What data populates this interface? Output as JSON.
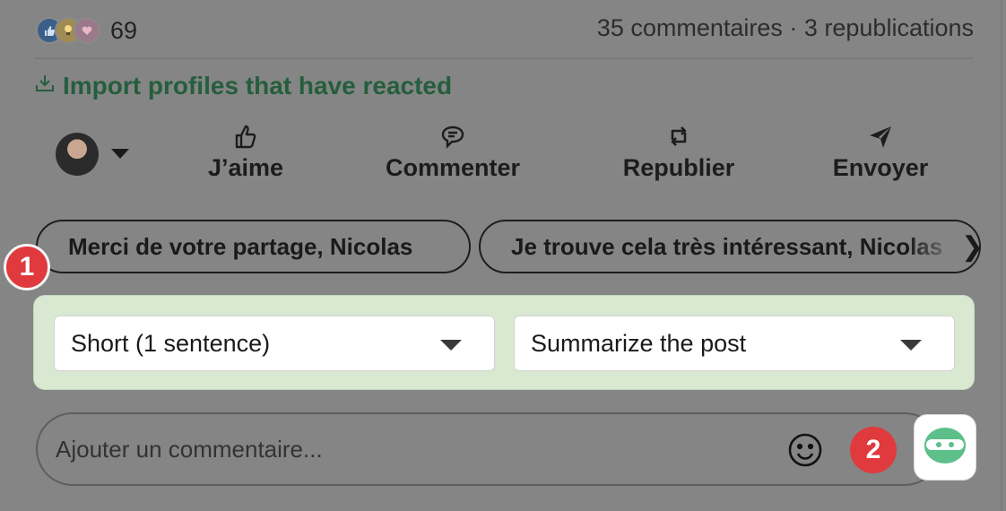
{
  "reactions": {
    "icons": [
      "like-icon",
      "insightful-icon",
      "love-icon"
    ],
    "count": "69"
  },
  "stats": {
    "text": "35 commentaires · 3 republications"
  },
  "import": {
    "label": "Import profiles that have reacted",
    "icon": "download-icon",
    "color": "#255e3d"
  },
  "actions": [
    {
      "label": "J’aime",
      "icon": "thumbs-up-icon"
    },
    {
      "label": "Commenter",
      "icon": "comment-icon"
    },
    {
      "label": "Republier",
      "icon": "repost-icon"
    },
    {
      "label": "Envoyer",
      "icon": "send-icon"
    }
  ],
  "suggestions": [
    "Merci de votre partage, Nicolas",
    "Je trouve cela très intéressant, Nicolas"
  ],
  "badges": [
    "1",
    "2"
  ],
  "dropdowns": {
    "length": "Short (1 sentence)",
    "mode": "Summarize the post"
  },
  "comment": {
    "placeholder": "Ajouter un commentaire..."
  },
  "colors": {
    "green_panel": "#d9e8d1",
    "badge_red": "#e0393e",
    "bot_green": "#5dbf8a"
  }
}
